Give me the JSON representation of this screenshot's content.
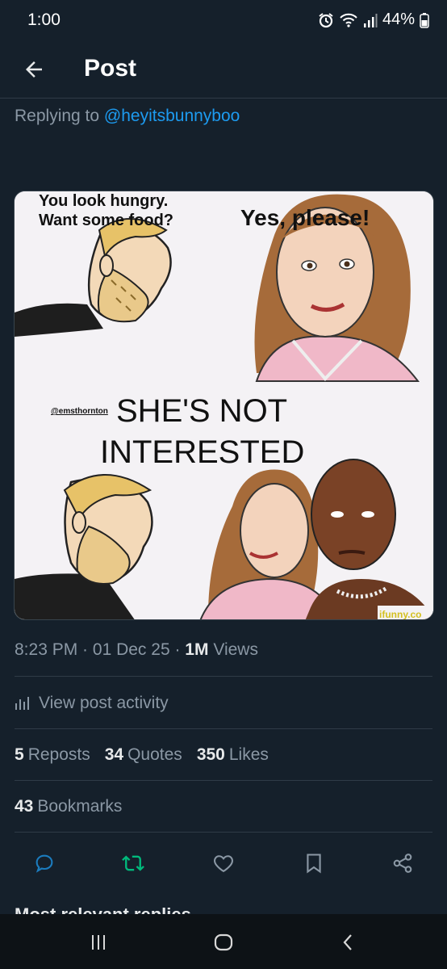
{
  "status_bar": {
    "time": "1:00",
    "battery": "44%",
    "icons": [
      "alarm-icon",
      "wifi-icon",
      "signal-icon",
      "battery-icon"
    ]
  },
  "header": {
    "title": "Post",
    "back_icon": "arrow-left-icon"
  },
  "reply": {
    "prefix": "Replying to ",
    "handle": "@heyitsbunnyboo"
  },
  "meme": {
    "top_left_line1": "You look hungry.",
    "top_left_line2": "Want some food?",
    "top_right": "Yes, please!",
    "watermark_small": "@emsthornton",
    "middle_line1": "SHE'S NOT",
    "middle_line2": "INTERESTED",
    "corner_watermark": "ifunny.co"
  },
  "meta": {
    "time": "8:23 PM",
    "sep1": " · ",
    "date": "01 Dec 25",
    "sep2": " · ",
    "views_count": "1M",
    "views_label": " Views"
  },
  "activity": {
    "icon": "bar-chart-icon",
    "label": "View post activity"
  },
  "stats": {
    "reposts_count": "5",
    "reposts_label": "Reposts",
    "quotes_count": "34",
    "quotes_label": "Quotes",
    "likes_count": "350",
    "likes_label": "Likes",
    "bookmarks_count": "43",
    "bookmarks_label": "Bookmarks"
  },
  "actions": [
    "reply-icon",
    "repost-icon",
    "like-icon",
    "bookmark-icon",
    "share-icon"
  ],
  "cutoff_text": "Most relevant replies",
  "colors": {
    "background": "#15202b",
    "accent": "#1d9bf0",
    "repost_green": "#00ba7c",
    "muted": "#8b98a5"
  }
}
